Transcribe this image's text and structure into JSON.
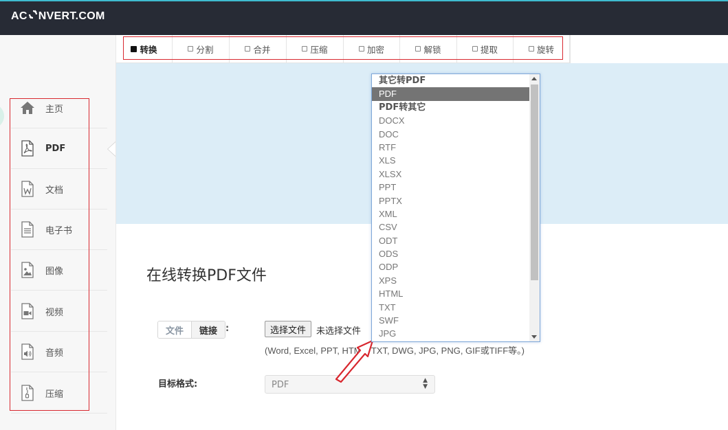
{
  "logo": {
    "left": "AC",
    "right": "NVERT.COM"
  },
  "tabs": [
    {
      "label": "转换",
      "active": true
    },
    {
      "label": "分割"
    },
    {
      "label": "合并"
    },
    {
      "label": "压缩"
    },
    {
      "label": "加密"
    },
    {
      "label": "解锁"
    },
    {
      "label": "提取"
    },
    {
      "label": "旋转"
    }
  ],
  "sidebar": {
    "items": [
      {
        "label": "主页",
        "icon": "home-icon"
      },
      {
        "label": "PDF",
        "icon": "pdf-file-icon",
        "active": true
      },
      {
        "label": "文档",
        "icon": "word-document-icon"
      },
      {
        "label": "电子书",
        "icon": "ebook-icon"
      },
      {
        "label": "图像",
        "icon": "image-file-icon"
      },
      {
        "label": "视频",
        "icon": "video-file-icon"
      },
      {
        "label": "音频",
        "icon": "audio-file-icon"
      },
      {
        "label": "压缩",
        "icon": "archive-file-icon"
      }
    ]
  },
  "main": {
    "title": "在线转换PDF文件",
    "source_tabs": {
      "file": "文件",
      "link": "链接"
    },
    "colon": ":",
    "choose_file_button": "选择文件",
    "no_file_text": "未选择文件",
    "supported_hint": "(Word, Excel, PPT, HTML, TXT, DWG, JPG, PNG, GIF或TIFF等。)",
    "stray_char": "(",
    "target_format_label": "目标格式:",
    "target_format_value": "PDF"
  },
  "dropdown": {
    "options": [
      {
        "label": "其它转PDF",
        "group": true
      },
      {
        "label": "PDF",
        "selected": true
      },
      {
        "label": "PDF转其它",
        "group": true
      },
      {
        "label": "DOCX"
      },
      {
        "label": "DOC"
      },
      {
        "label": "RTF"
      },
      {
        "label": "XLS"
      },
      {
        "label": "XLSX"
      },
      {
        "label": "PPT"
      },
      {
        "label": "PPTX"
      },
      {
        "label": "XML"
      },
      {
        "label": "CSV"
      },
      {
        "label": "ODT"
      },
      {
        "label": "ODS"
      },
      {
        "label": "ODP"
      },
      {
        "label": "XPS"
      },
      {
        "label": "HTML"
      },
      {
        "label": "TXT"
      },
      {
        "label": "SWF"
      },
      {
        "label": "JPG"
      }
    ]
  },
  "colors": {
    "topbar": "#272b35",
    "hero": "#dcedf7",
    "annotation_red": "#d8272e",
    "selected_option": "#747474"
  }
}
